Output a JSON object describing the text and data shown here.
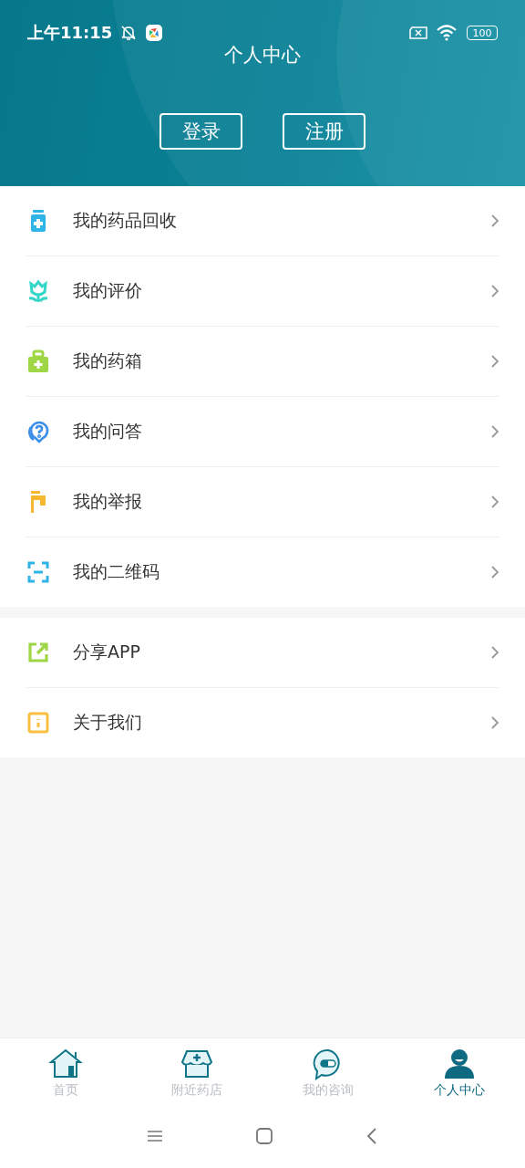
{
  "status_bar": {
    "time": "上午11:15",
    "battery": "100"
  },
  "header": {
    "title": "个人中心",
    "buttons": [
      "登录",
      "注册"
    ]
  },
  "menu_groups": [
    [
      {
        "label": "我的药品回收",
        "kind": "bottle",
        "color": "#2eb4e6"
      },
      {
        "label": "我的评价",
        "kind": "flower",
        "color": "#33d6c8"
      },
      {
        "label": "我的药箱",
        "kind": "kit",
        "color": "#9ed645"
      },
      {
        "label": "我的问答",
        "kind": "question",
        "color": "#3d8fe8"
      },
      {
        "label": "我的举报",
        "kind": "flag",
        "color": "#f7b731"
      },
      {
        "label": "我的二维码",
        "kind": "scan",
        "color": "#2eb4e6"
      }
    ],
    [
      {
        "label": "分享APP",
        "kind": "share",
        "color": "#9ed645"
      },
      {
        "label": "关于我们",
        "kind": "info",
        "color": "#f7c040"
      }
    ]
  ],
  "tab_bar": [
    {
      "label": "首页",
      "kind": "home",
      "selected": false
    },
    {
      "label": "附近药店",
      "kind": "store",
      "selected": false
    },
    {
      "label": "我的咨询",
      "kind": "chat",
      "selected": false
    },
    {
      "label": "个人中心",
      "kind": "person",
      "selected": true
    }
  ]
}
